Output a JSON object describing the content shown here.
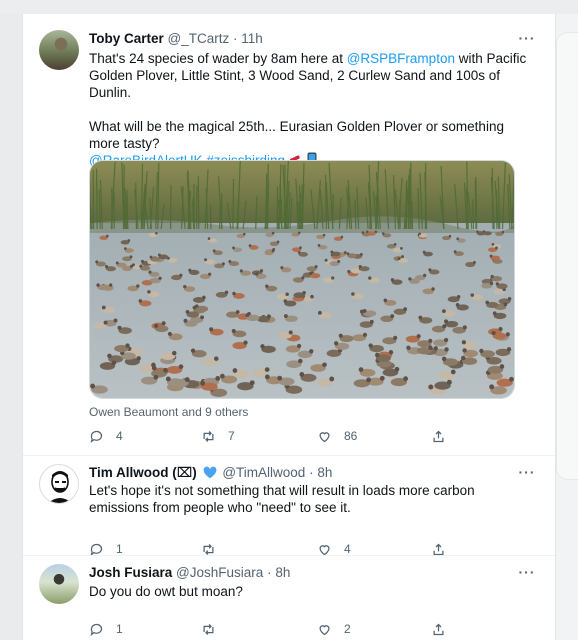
{
  "tweets": [
    {
      "name": "Toby Carter",
      "handle": "@_TCartz",
      "separator": "·",
      "time": "11h",
      "text_line1_a": "That's 24 species of wader by 8am here at ",
      "mention1": "@RSPBFrampton",
      "text_line1_b": " with Pacific Golden Plover, Little Stint, 3 Wood Sand, 2 Curlew Sand and 100s of Dunlin.",
      "text_para2": "What will be the magical 25th... Eurasian Golden Plover or something more tasty?",
      "mention2": "@RareBirdAlertUK",
      "hashtag": "#zeissbirding",
      "emoji_icons": [
        "telescope-icon",
        "mobile-phone-icon"
      ],
      "likers": "Owen Beaumont and 9 others",
      "replies": "4",
      "retweets": "7",
      "likes": "86"
    },
    {
      "name": "Tim Allwood (⌧)",
      "verified_color": "#4aa3f0",
      "handle": "@TimAllwood",
      "separator": "·",
      "time": "8h",
      "text": "Let's hope it's not something that will result in loads more carbon emissions from people who \"need\" to see it.",
      "replies": "1",
      "retweets": "",
      "likes": "4"
    },
    {
      "name": "Josh Fusiara",
      "handle": "@JoshFusiara",
      "separator": "·",
      "time": "8h",
      "text": "Do you do owt but moan?",
      "replies": "1",
      "retweets": "",
      "likes": "2"
    }
  ],
  "more_label": "···",
  "colors": {
    "link": "#1d9bf0",
    "muted": "#536471",
    "text": "#0f1419"
  }
}
